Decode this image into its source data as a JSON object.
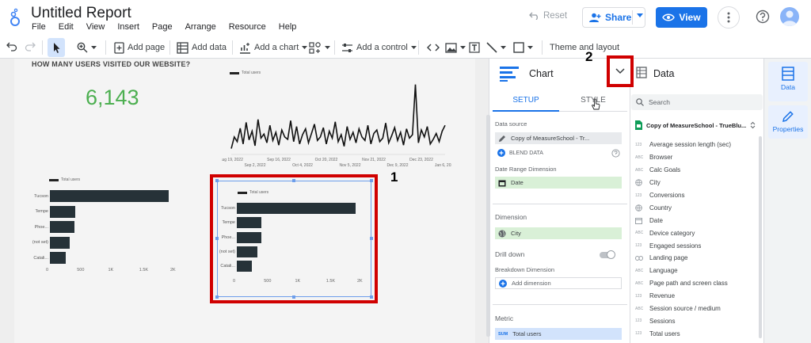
{
  "header": {
    "title": "Untitled Report",
    "menu": [
      "File",
      "Edit",
      "View",
      "Insert",
      "Page",
      "Arrange",
      "Resource",
      "Help"
    ],
    "reset_label": "Reset",
    "share_label": "Share",
    "view_label": "View"
  },
  "toolbar": {
    "add_page": "Add page",
    "add_data": "Add data",
    "add_chart": "Add a chart",
    "add_control": "Add a control",
    "theme_layout": "Theme and layout"
  },
  "canvas": {
    "scorecard_title": "HOW MANY USERS VISITED OUR WEBSITE?",
    "scorecard_value": "6,143",
    "legend_label": "Total users",
    "annotation_1": "1",
    "annotation_2": "2"
  },
  "chart_data": [
    {
      "type": "line",
      "series": [
        {
          "name": "Total users",
          "values": [
            10,
            30,
            22,
            45,
            18,
            55,
            25,
            40,
            15,
            60,
            28,
            35,
            20,
            50,
            24,
            38,
            16,
            42,
            30,
            26,
            58,
            22,
            48,
            18,
            34,
            44,
            20,
            36,
            52,
            24,
            30,
            46,
            18,
            40,
            28,
            56,
            22,
            34,
            14,
            48,
            26,
            38,
            20,
            44,
            30,
            24,
            50,
            18,
            36,
            42,
            22,
            28,
            54,
            20,
            32,
            46,
            24,
            38,
            16,
            44,
            28,
            34,
            120,
            20,
            42,
            30,
            48,
            18,
            26,
            36,
            22,
            40,
            50
          ]
        }
      ],
      "x_ticks": [
        "Aug 19, 2022",
        "Sep 2, 2022",
        "Sep 16, 2022",
        "Oct 4, 2022",
        "Oct 20, 2022",
        "Nov 5, 2022",
        "Nov 21, 2022",
        "Dec 9, 2022",
        "Dec 23, 2022",
        "Jan 6, 2023"
      ]
    },
    {
      "type": "bar",
      "series": [
        {
          "name": "Total users",
          "values": [
            1910,
            410,
            400,
            320,
            250
          ]
        }
      ],
      "categories": [
        "Tucson",
        "Tempe",
        "Phoe...",
        "(not set)",
        "Catali..."
      ],
      "x_ticks": [
        "0",
        "500",
        "1K",
        "1.5K",
        "2K"
      ],
      "xlim": [
        0,
        2000
      ]
    },
    {
      "type": "bar",
      "series": [
        {
          "name": "Total users",
          "values": [
            1910,
            400,
            390,
            330,
            240
          ]
        }
      ],
      "categories": [
        "Tucson",
        "Tempe",
        "Phoe...",
        "(not set)",
        "Catali..."
      ],
      "x_ticks": [
        "0",
        "500",
        "1K",
        "1.5K",
        "2K"
      ],
      "xlim": [
        0,
        2000
      ]
    }
  ],
  "panel": {
    "chart_type": "Chart",
    "data_title": "Data",
    "tab_setup": "SETUP",
    "tab_style": "STYLE",
    "data_source_label": "Data source",
    "data_source_value": "Copy of MeasureSchool - Tr...",
    "blend_data": "BLEND DATA",
    "date_range_label": "Date Range Dimension",
    "date_range_value": "Date",
    "dimension_label": "Dimension",
    "dimension_value": "City",
    "drill_down": "Drill down",
    "breakdown_label": "Breakdown Dimension",
    "add_dimension": "Add dimension",
    "metric_label": "Metric",
    "metric_agg": "SUM",
    "metric_value": "Total users"
  },
  "data_panel": {
    "search_placeholder": "Search",
    "source_name": "Copy of MeasureSchool - TrueBlu...",
    "fields": [
      {
        "type": "123",
        "name": "Average session length (sec)"
      },
      {
        "type": "ABC",
        "name": "Browser"
      },
      {
        "type": "ABC",
        "name": "Calc Goals"
      },
      {
        "type": "geo",
        "name": "City"
      },
      {
        "type": "123",
        "name": "Conversions"
      },
      {
        "type": "geo",
        "name": "Country"
      },
      {
        "type": "cal",
        "name": "Date"
      },
      {
        "type": "ABC",
        "name": "Device category"
      },
      {
        "type": "123",
        "name": "Engaged sessions"
      },
      {
        "type": "link",
        "name": "Landing page"
      },
      {
        "type": "ABC",
        "name": "Language"
      },
      {
        "type": "ABC",
        "name": "Page path and screen class"
      },
      {
        "type": "123",
        "name": "Revenue"
      },
      {
        "type": "ABC",
        "name": "Session source / medium"
      },
      {
        "type": "123",
        "name": "Sessions"
      },
      {
        "type": "123",
        "name": "Total users"
      }
    ]
  },
  "side_tabs": {
    "data": "Data",
    "properties": "Properties"
  },
  "colors": {
    "accent": "#1a73e8",
    "highlight": "#d00000",
    "score": "#4caf50",
    "bar": "#263238"
  }
}
